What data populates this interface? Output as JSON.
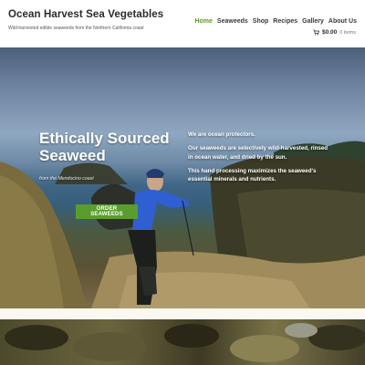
{
  "header": {
    "site_title": "Ocean Harvest Sea Vegetables",
    "tagline": "Wild-harvested edible seaweeds from the Northern California coast",
    "nav": [
      "Home",
      "Seaweeds",
      "Shop",
      "Recipes",
      "Gallery",
      "About Us"
    ],
    "active_nav": "Home",
    "cart": {
      "price": "$0.00",
      "count": "0 items",
      "icon": "cart-icon"
    }
  },
  "hero": {
    "title": "Ethically Sourced Seaweed",
    "subtitle": "from the Mendocino coast",
    "button_label": "ORDER SEAWEEDS",
    "paragraphs": [
      "We are ocean protectors.",
      "Our seaweeds are selectively wild-harvested, rinsed in ocean water, and dried by the sun.",
      "This hand processing maximizes the seaweed's essential minerals and nutrients."
    ]
  },
  "colors": {
    "accent_green": "#5a9d2d",
    "nav_active": "#5a9a28",
    "title_text": "#2b2b2b"
  }
}
